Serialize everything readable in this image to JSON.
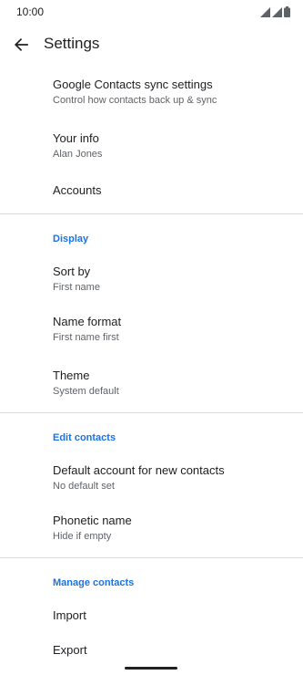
{
  "status_bar": {
    "time": "10:00",
    "icons": [
      "signal-icon",
      "signal-icon",
      "battery-icon"
    ]
  },
  "app_bar": {
    "title": "Settings",
    "back_icon": "arrow-back-icon"
  },
  "items": {
    "sync": {
      "title": "Google Contacts sync settings",
      "subtitle": "Control how contacts back up & sync"
    },
    "your_info": {
      "title": "Your info",
      "subtitle": "Alan Jones"
    },
    "accounts": {
      "title": "Accounts"
    }
  },
  "sections": {
    "display": {
      "header": "Display",
      "sort_by": {
        "title": "Sort by",
        "subtitle": "First name"
      },
      "name_format": {
        "title": "Name format",
        "subtitle": "First name first"
      },
      "theme": {
        "title": "Theme",
        "subtitle": "System default"
      }
    },
    "edit_contacts": {
      "header": "Edit contacts",
      "default_account": {
        "title": "Default account for new contacts",
        "subtitle": "No default set"
      },
      "phonetic_name": {
        "title": "Phonetic name",
        "subtitle": "Hide if empty"
      }
    },
    "manage_contacts": {
      "header": "Manage contacts",
      "import": {
        "title": "Import"
      },
      "export": {
        "title": "Export"
      }
    }
  },
  "colors": {
    "accent": "#1a73e8",
    "text_primary": "#202124",
    "text_secondary": "#5f6368",
    "divider": "#dadce0"
  }
}
